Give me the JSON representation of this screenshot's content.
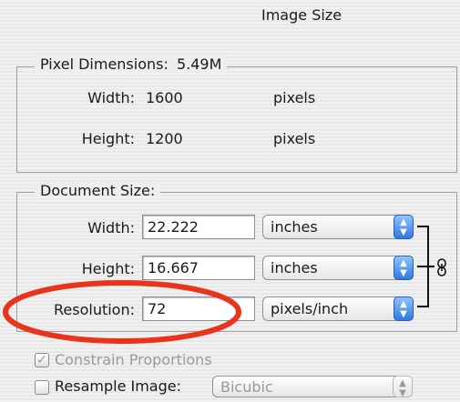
{
  "dialog": {
    "title": "Image Size"
  },
  "pixel_dimensions": {
    "legend": "Pixel Dimensions:",
    "size": "5.49M",
    "width": {
      "label": "Width:",
      "value": "1600",
      "unit": "pixels"
    },
    "height": {
      "label": "Height:",
      "value": "1200",
      "unit": "pixels"
    }
  },
  "document_size": {
    "legend": "Document Size:",
    "width": {
      "label": "Width:",
      "value": "22.222",
      "unit": "inches"
    },
    "height": {
      "label": "Height:",
      "value": "16.667",
      "unit": "inches"
    },
    "resolution": {
      "label": "Resolution:",
      "value": "72",
      "unit": "pixels/inch"
    }
  },
  "options": {
    "constrain_proportions": {
      "label": "Constrain Proportions",
      "checked": true,
      "check_glyph": "✓"
    },
    "resample_image": {
      "label": "Resample Image:",
      "checked": false,
      "method": "Bicubic"
    }
  },
  "icons": {
    "link": "link-chain-icon",
    "stepper": "up-down-arrows-icon"
  },
  "colors": {
    "annotation": "#e8341c",
    "accent": "#2f78e0"
  }
}
